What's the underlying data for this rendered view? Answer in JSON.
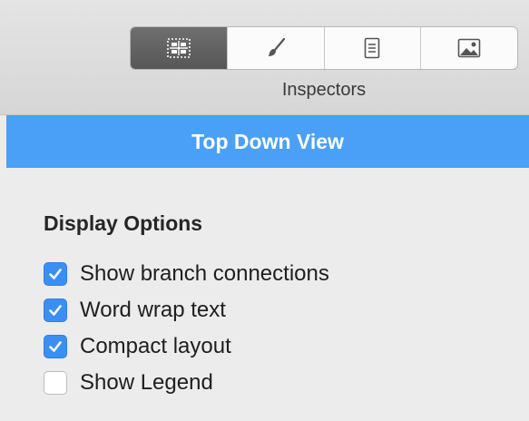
{
  "toolbar": {
    "segments": [
      {
        "icon": "layout-grid-icon",
        "active": true
      },
      {
        "icon": "paintbrush-icon",
        "active": false
      },
      {
        "icon": "document-icon",
        "active": false
      },
      {
        "icon": "image-icon",
        "active": false
      }
    ],
    "label": "Inspectors"
  },
  "view": {
    "title": "Top Down View"
  },
  "display_options": {
    "title": "Display Options",
    "items": [
      {
        "label": "Show branch connections",
        "checked": true
      },
      {
        "label": "Word wrap text",
        "checked": true
      },
      {
        "label": "Compact layout",
        "checked": true
      },
      {
        "label": "Show Legend",
        "checked": false
      }
    ]
  },
  "colors": {
    "accent": "#4aa0f6",
    "checkbox_checked": "#3b8ff2",
    "segment_active": "#5f5f5f"
  }
}
